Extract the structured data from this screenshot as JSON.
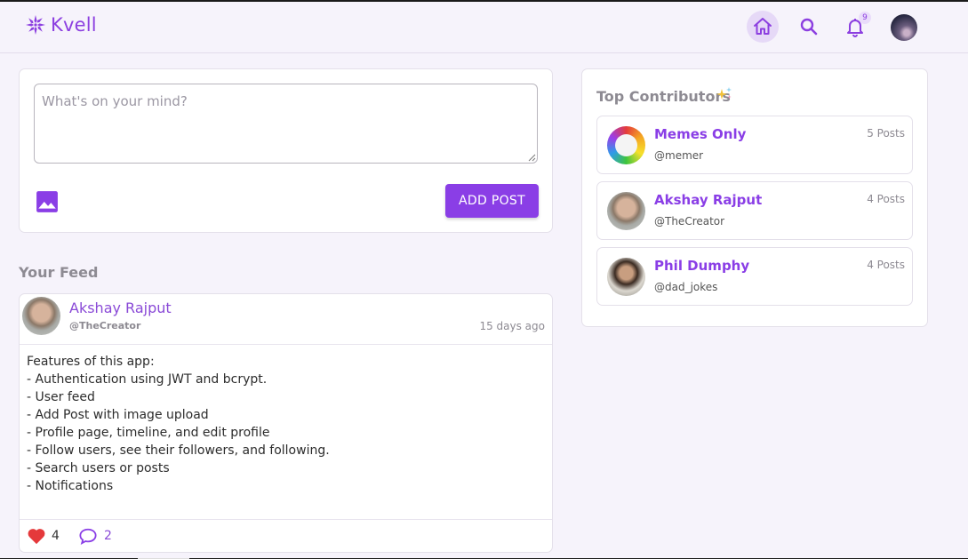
{
  "header": {
    "brand": "Kvell",
    "notification_count": "9",
    "icons": {
      "logo": "snowflake-logo-icon",
      "home": "home-icon",
      "search": "search-icon",
      "notifications": "bell-icon"
    },
    "colors": {
      "accent": "#8a3ee6",
      "home_active_bg": "#e6d9f7"
    }
  },
  "composer": {
    "placeholder": "What's on your mind?",
    "image_icon": "image-icon",
    "add_post_label": "ADD POST"
  },
  "feed": {
    "title": "Your Feed",
    "posts": [
      {
        "author": "Akshay Rajput",
        "handle": "@TheCreator",
        "time": "15 days ago",
        "body": "Features of this app:\n- Authentication using JWT and bcrypt.\n- User feed\n- Add Post with image upload\n- Profile page, timeline, and edit profile\n- Follow users, see their followers, and following.\n- Search users or posts\n- Notifications",
        "likes": "4",
        "comments": "2"
      }
    ]
  },
  "contributors": {
    "title": "Top Contributors",
    "items": [
      {
        "name": "Memes Only",
        "handle": "@memer",
        "posts": "5 Posts"
      },
      {
        "name": "Akshay Rajput",
        "handle": "@TheCreator",
        "posts": "4 Posts"
      },
      {
        "name": "Phil Dumphy",
        "handle": "@dad_jokes",
        "posts": "4 Posts"
      }
    ]
  }
}
